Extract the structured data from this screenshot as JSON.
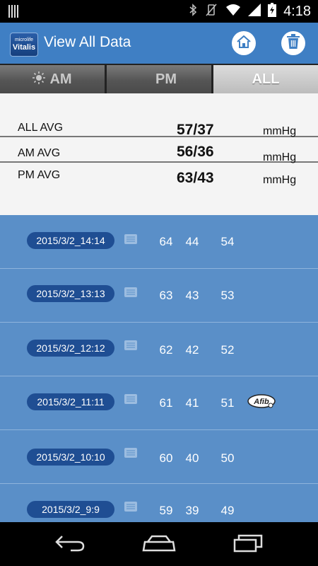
{
  "status_bar": {
    "time": "4:18",
    "icons": [
      "notification-bars-icon",
      "bluetooth-icon",
      "vibrate-off-icon",
      "wifi-icon",
      "signal-icon",
      "battery-charging-icon"
    ]
  },
  "header": {
    "logo_line1": "microlife",
    "logo_line2": "Vitalis",
    "title": "View All Data",
    "home_icon": "home-icon",
    "trash_icon": "trash-icon"
  },
  "tabs": [
    {
      "label": "AM",
      "icon": "sun-icon",
      "active": false
    },
    {
      "label": "PM",
      "icon": "moon-icon",
      "active": false
    },
    {
      "label": "ALL",
      "icon": "",
      "active": true
    }
  ],
  "summary": [
    {
      "label": "ALL AVG",
      "value": "57/37",
      "unit": "mmHg"
    },
    {
      "label": "AM AVG",
      "value": "56/36",
      "unit": "mmHg"
    },
    {
      "label": "PM AVG",
      "value": "63/43",
      "unit": "mmHg"
    }
  ],
  "records": [
    {
      "date": "2015/3/2_14:14",
      "sys": "64",
      "dia": "44",
      "pulse": "54",
      "afib": false
    },
    {
      "date": "2015/3/2_13:13",
      "sys": "63",
      "dia": "43",
      "pulse": "53",
      "afib": false
    },
    {
      "date": "2015/3/2_12:12",
      "sys": "62",
      "dia": "42",
      "pulse": "52",
      "afib": false
    },
    {
      "date": "2015/3/2_11:11",
      "sys": "61",
      "dia": "41",
      "pulse": "51",
      "afib": true,
      "afib_label": "Afib"
    },
    {
      "date": "2015/3/2_10:10",
      "sys": "60",
      "dia": "40",
      "pulse": "50",
      "afib": false
    },
    {
      "date": "2015/3/2_9:9",
      "sys": "59",
      "dia": "39",
      "pulse": "49",
      "afib": false
    }
  ],
  "nav_bar": {
    "icons": [
      "back-icon",
      "home-nav-icon",
      "recent-apps-icon"
    ]
  },
  "colors": {
    "action_bar": "#3f7fc4",
    "list_bg": "#5a8fc8",
    "date_pill": "#1f4e93"
  }
}
